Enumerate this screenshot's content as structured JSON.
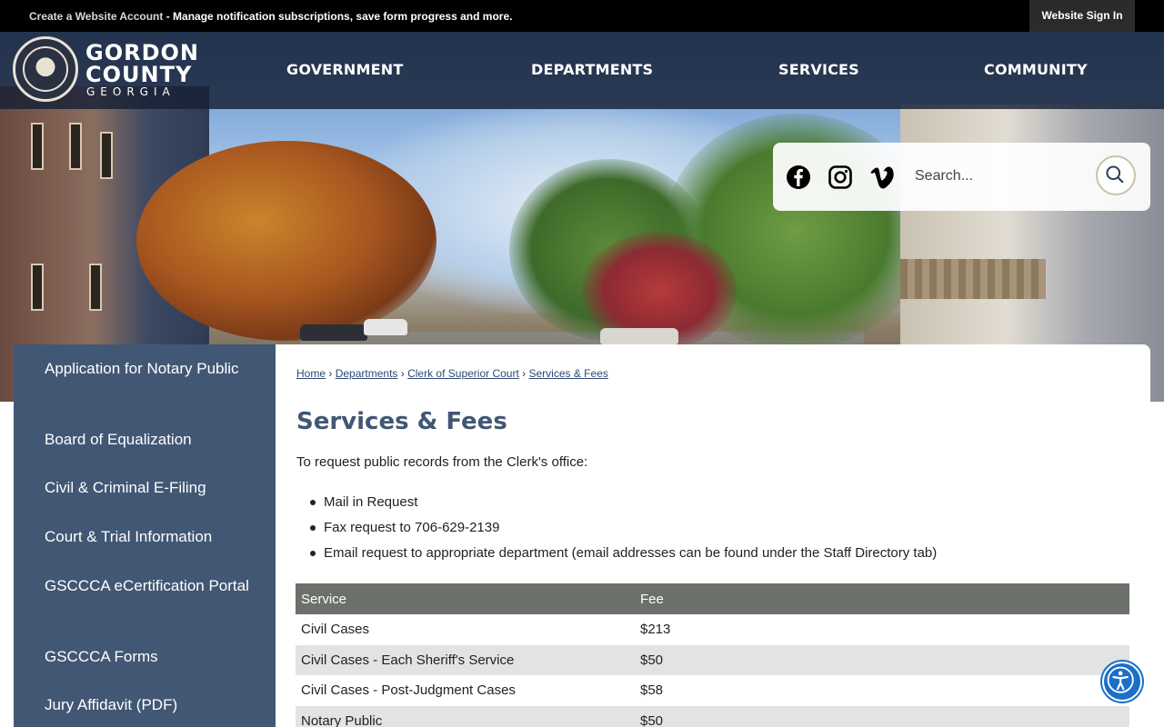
{
  "topbar": {
    "account_link": "Create a Website Account",
    "account_message": " - Manage notification subscriptions, save form progress and more.",
    "signin": "Website Sign In"
  },
  "header": {
    "logo_line1": "GORDON",
    "logo_line2": "COUNTY",
    "logo_line3": "GEORGIA",
    "nav": [
      "GOVERNMENT",
      "DEPARTMENTS",
      "SERVICES",
      "COMMUNITY"
    ]
  },
  "utility": {
    "social": [
      "facebook-icon",
      "instagram-icon",
      "vimeo-icon"
    ],
    "search_placeholder": "Search..."
  },
  "sidebar": {
    "items": [
      "Application for Notary Public",
      "Board of Equalization",
      "Civil & Criminal E-Filing",
      "Court & Trial Information",
      "GSCCCA eCertification Portal",
      "GSCCCA Forms",
      "Jury Affidavit (PDF)"
    ]
  },
  "breadcrumb": {
    "items": [
      "Home",
      "Departments",
      "Clerk of Superior Court",
      "Services & Fees"
    ]
  },
  "main": {
    "title": "Services & Fees",
    "intro": "To request public records from the Clerk's office:",
    "bullets": [
      "Mail in Request",
      "Fax request to 706-629-2139",
      "Email request to appropriate department (email addresses can be found under the Staff Directory tab)"
    ],
    "table": {
      "headers": [
        "Service",
        "Fee"
      ],
      "rows": [
        [
          "Civil Cases",
          "$213"
        ],
        [
          "Civil Cases - Each Sheriff's Service",
          "$50"
        ],
        [
          "Civil Cases - Post-Judgment Cases",
          "$58"
        ],
        [
          "Notary Public",
          "$50"
        ]
      ]
    }
  },
  "colors": {
    "sidebar_bg": "#425774",
    "table_header_bg": "#6c706a",
    "title_color": "#425774",
    "a11y_button": "#1b6fc9"
  }
}
